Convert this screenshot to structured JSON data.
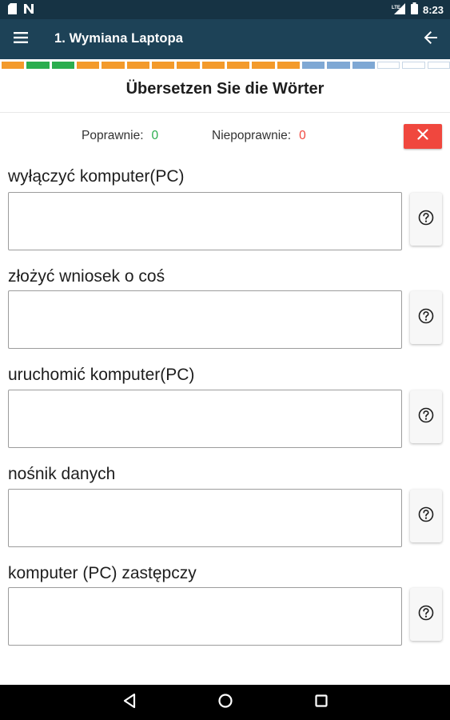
{
  "status_bar": {
    "time": "8:23",
    "network_label": "LTE",
    "icons": [
      "sd-card-icon",
      "notification-n-icon",
      "signal-icon",
      "battery-icon"
    ]
  },
  "app_bar": {
    "title": "1. Wymiana Laptopa",
    "icons": [
      "menu-icon",
      "back-arrow-icon"
    ]
  },
  "progress": {
    "segments": [
      "orange",
      "green",
      "green",
      "orange",
      "orange",
      "orange",
      "orange",
      "orange",
      "orange",
      "orange",
      "orange",
      "orange",
      "blue",
      "blue",
      "blue",
      "empty",
      "empty",
      "empty"
    ],
    "colors": {
      "orange": "#f39a2b",
      "green": "#2bad4e",
      "blue": "#7fa8d4",
      "empty": "#ffffff"
    }
  },
  "header": {
    "title": "Übersetzen Sie die Wörter"
  },
  "stats": {
    "correct_label": "Poprawnie:",
    "correct_value": "0",
    "correct_color": "#2bad4e",
    "incorrect_label": "Niepoprawnie:",
    "incorrect_value": "0",
    "incorrect_color": "#f0473e"
  },
  "words": [
    {
      "label": "wyłączyć komputer(PC)",
      "value": "",
      "placeholder": ""
    },
    {
      "label": "złożyć wniosek o coś",
      "value": "",
      "placeholder": ""
    },
    {
      "label": "uruchomić komputer(PC)",
      "value": "",
      "placeholder": ""
    },
    {
      "label": "nośnik danych",
      "value": "",
      "placeholder": ""
    },
    {
      "label": "komputer (PC) zastępczy",
      "value": "",
      "placeholder": ""
    }
  ],
  "hint_icon": "help-circle-icon",
  "nav_bar": {
    "icons": [
      "back-triangle-icon",
      "home-circle-icon",
      "recents-square-icon"
    ]
  }
}
